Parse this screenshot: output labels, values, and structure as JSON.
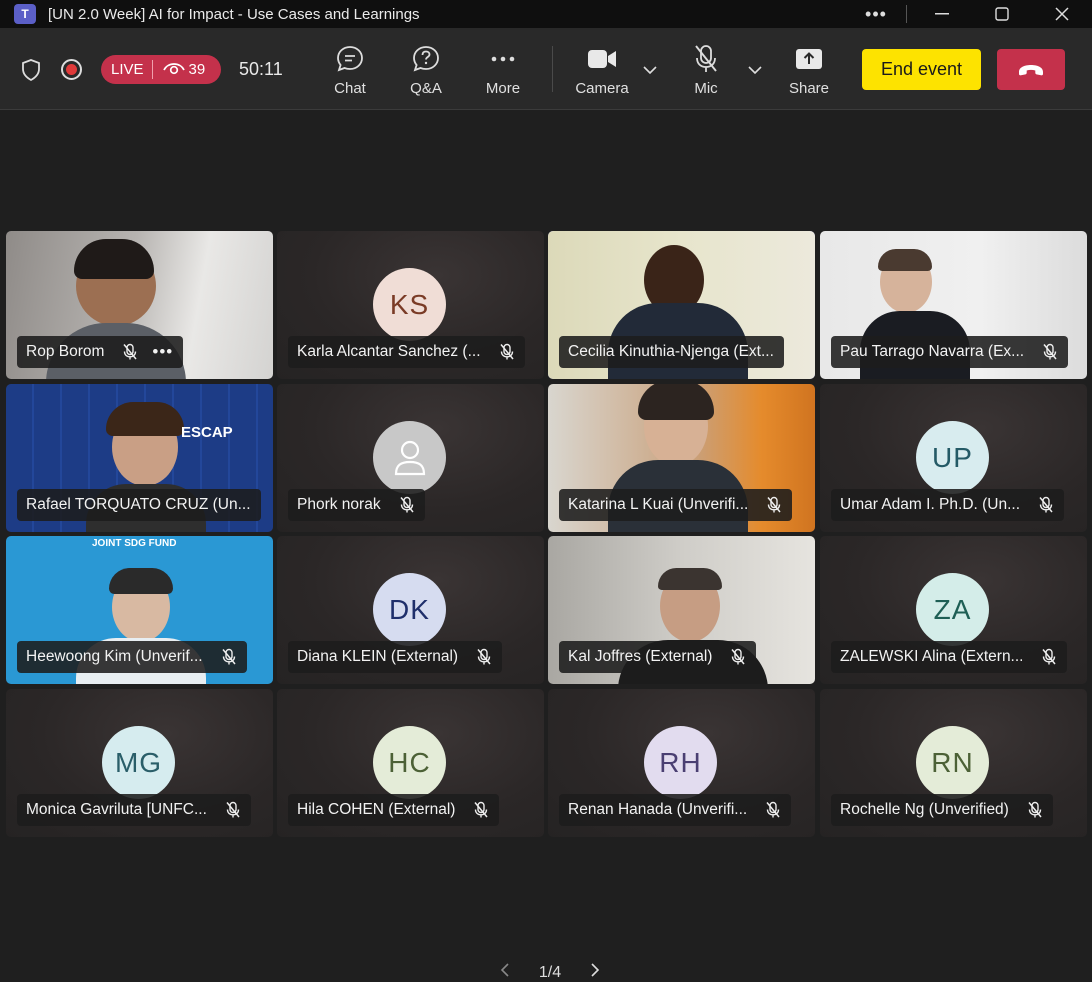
{
  "window": {
    "app_icon_label": "T",
    "title": "[UN 2.0 Week] AI for Impact - Use Cases and Learnings"
  },
  "toolbar": {
    "live_label": "LIVE",
    "viewer_count": "39",
    "timer": "50:11",
    "buttons": {
      "chat": "Chat",
      "qa": "Q&A",
      "more": "More",
      "camera": "Camera",
      "mic": "Mic",
      "share": "Share"
    },
    "end_event_label": "End event",
    "colors": {
      "live": "#c4314b",
      "end_event": "#fde300",
      "hangup": "#c4314b"
    }
  },
  "participants": [
    {
      "name": "Rop Borom",
      "type": "video",
      "muted": true,
      "has_more": true
    },
    {
      "name": "Karla Alcantar Sanchez (...",
      "type": "avatar",
      "initials": "KS",
      "avatar_bg": "#f0ddd6",
      "avatar_fg": "#7a3b26",
      "muted": true
    },
    {
      "name": "Cecilia Kinuthia-Njenga (Ext...",
      "type": "video",
      "muted": false,
      "active_speaker": true
    },
    {
      "name": "Pau Tarrago Navarra (Ex...",
      "type": "video",
      "muted": true
    },
    {
      "name": "Rafael TORQUATO CRUZ (Un...",
      "type": "video",
      "muted": false,
      "banner_text": "ESCAP"
    },
    {
      "name": "Phork norak",
      "type": "avatar",
      "initials": "",
      "avatar_bg": "#c2c2c2",
      "avatar_fg": "#ffffff",
      "muted": true,
      "generic_icon": "person-icon"
    },
    {
      "name": "Katarina L Kuai (Unverifi...",
      "type": "video",
      "muted": true
    },
    {
      "name": "Umar Adam I. Ph.D. (Un...",
      "type": "avatar",
      "initials": "UP",
      "avatar_bg": "#d8ecef",
      "avatar_fg": "#245a66",
      "muted": true
    },
    {
      "name": "Heewoong Kim (Unverif...",
      "type": "video",
      "muted": true,
      "banner_text": "JOINT SDG FUND"
    },
    {
      "name": "Diana KLEIN (External)",
      "type": "avatar",
      "initials": "DK",
      "avatar_bg": "#d6dcf0",
      "avatar_fg": "#1f2f6b",
      "muted": true
    },
    {
      "name": "Kal Joffres (External)",
      "type": "video",
      "muted": true
    },
    {
      "name": "ZALEWSKI Alina (Extern...",
      "type": "avatar",
      "initials": "ZA",
      "avatar_bg": "#d4ede9",
      "avatar_fg": "#1e5f55",
      "muted": true
    },
    {
      "name": "Monica Gavriluta [UNFC...",
      "type": "avatar",
      "initials": "MG",
      "avatar_bg": "#d6ecef",
      "avatar_fg": "#2a5e69",
      "muted": true
    },
    {
      "name": "Hila COHEN (External)",
      "type": "avatar",
      "initials": "HC",
      "avatar_bg": "#e4ecd8",
      "avatar_fg": "#4c6136",
      "muted": true
    },
    {
      "name": "Renan Hanada (Unverifi...",
      "type": "avatar",
      "initials": "RH",
      "avatar_bg": "#e2dcef",
      "avatar_fg": "#4a3f72",
      "muted": true
    },
    {
      "name": "Rochelle Ng (Unverified)",
      "type": "avatar",
      "initials": "RN",
      "avatar_bg": "#e4ecd8",
      "avatar_fg": "#4c6136",
      "muted": true
    }
  ],
  "pager": {
    "label": "1/4"
  }
}
